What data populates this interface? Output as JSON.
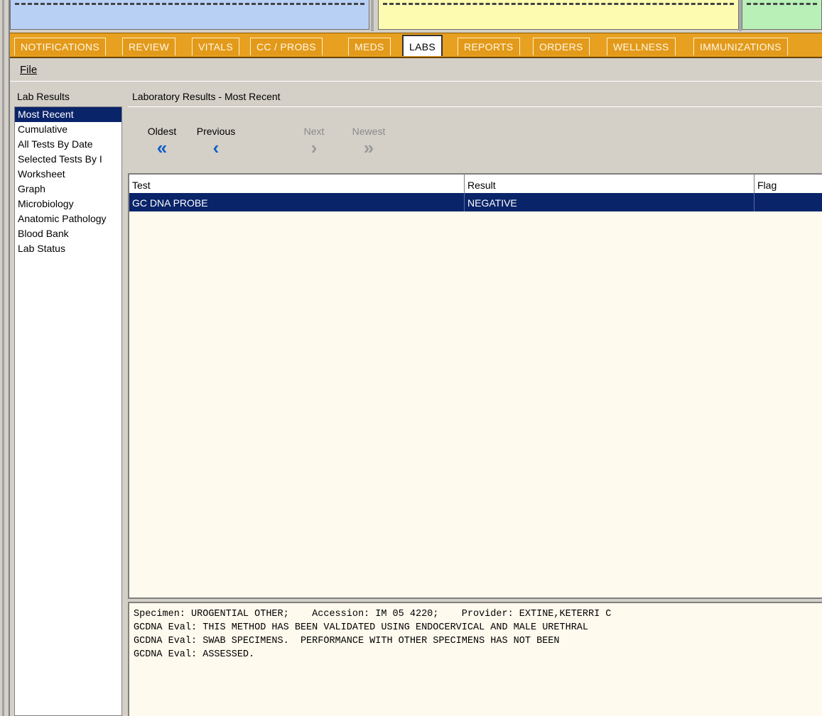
{
  "tabs": [
    {
      "label": "NOTIFICATIONS",
      "active": false
    },
    {
      "label": "REVIEW",
      "active": false
    },
    {
      "label": "VITALS",
      "active": false
    },
    {
      "label": "CC / PROBS",
      "active": false
    },
    {
      "label": "MEDS",
      "active": false
    },
    {
      "label": "LABS",
      "active": true
    },
    {
      "label": "REPORTS",
      "active": false
    },
    {
      "label": "ORDERS",
      "active": false
    },
    {
      "label": "WELLNESS",
      "active": false
    },
    {
      "label": "IMMUNIZATIONS",
      "active": false
    }
  ],
  "menu": {
    "file_label": "File"
  },
  "nav": {
    "header": "Lab Results",
    "items": [
      {
        "label": "Most Recent",
        "selected": true
      },
      {
        "label": "Cumulative",
        "selected": false
      },
      {
        "label": "All Tests By Date",
        "selected": false
      },
      {
        "label": "Selected Tests By I",
        "selected": false
      },
      {
        "label": "Worksheet",
        "selected": false
      },
      {
        "label": "Graph",
        "selected": false
      },
      {
        "label": "Microbiology",
        "selected": false
      },
      {
        "label": "Anatomic Pathology",
        "selected": false
      },
      {
        "label": "Blood Bank",
        "selected": false
      },
      {
        "label": "Lab Status",
        "selected": false
      }
    ]
  },
  "content": {
    "title": "Laboratory Results - Most Recent"
  },
  "pager": {
    "oldest": {
      "label": "Oldest",
      "icon": "double-chevron-left-icon",
      "enabled": true
    },
    "previous": {
      "label": "Previous",
      "icon": "chevron-left-icon",
      "enabled": true
    },
    "next": {
      "label": "Next",
      "icon": "chevron-right-icon",
      "enabled": false
    },
    "newest": {
      "label": "Newest",
      "icon": "double-chevron-right-icon",
      "enabled": false
    }
  },
  "results_table": {
    "columns": [
      "Test",
      "Result",
      "Flag"
    ],
    "rows": [
      {
        "test": "GC DNA PROBE",
        "result": "NEGATIVE",
        "flag": "",
        "selected": true
      }
    ]
  },
  "detail": {
    "lines": [
      "Specimen: UROGENTIAL OTHER;    Accession: IM 05 4220;    Provider: EXTINE,KETERRI C",
      "GCDNA Eval: THIS METHOD HAS BEEN VALIDATED USING ENDOCERVICAL AND MALE URETHRAL",
      "GCDNA Eval: SWAB SPECIMENS.  PERFORMANCE WITH OTHER SPECIMENS HAS NOT BEEN",
      "GCDNA Eval: ASSESSED."
    ]
  },
  "colors": {
    "tab_bar": "#e8a020",
    "selection": "#0a246a",
    "panel_blue": "#b9d0f5",
    "panel_yellow": "#fdfbb0",
    "panel_green": "#b8f0b8",
    "pager_arrow": "#0f5fc6"
  }
}
